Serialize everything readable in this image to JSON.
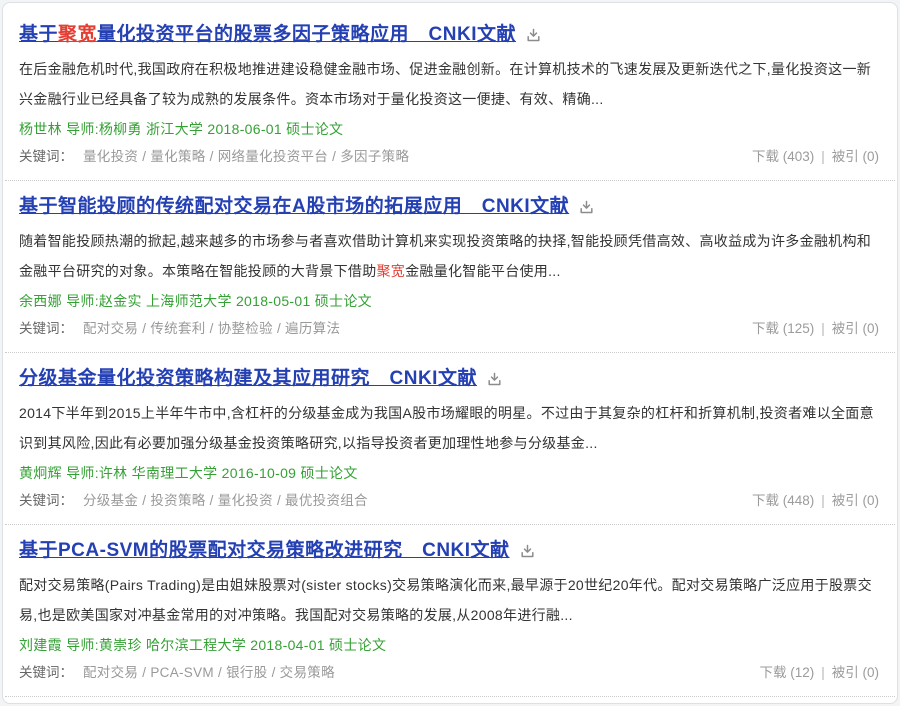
{
  "page": {
    "background_color": "#f2f4f5",
    "container_background": "#ffffff",
    "container_border_color": "#dde0e4"
  },
  "colors": {
    "link_blue": "#2440b3",
    "highlight_red": "#e33e33",
    "author_green": "#35a135",
    "abstract_text": "#333333",
    "keyword_gray": "#999999",
    "stats_gray": "#9b9b9b"
  },
  "icons": {
    "download": "tray-arrow-down-icon"
  },
  "labels": {
    "keywords_label": "关键词：",
    "keyword_separator": "/",
    "stats_divider": "|"
  },
  "results": [
    {
      "title_parts": [
        {
          "text": "基于"
        },
        {
          "text": "聚宽",
          "highlight": true
        },
        {
          "text": "量化投资平台的股票多因子策略应用　CNKI文献"
        }
      ],
      "abstract_parts": [
        {
          "text": "在后金融危机时代,我国政府在积极地推进建设稳健金融市场、促进金融创新。在计算机技术的飞速发展及更新迭代之下,量化投资这一新兴金融行业已经具备了较为成熟的发展条件。资本市场对于量化投资这一便捷、有效、精确..."
        }
      ],
      "author_line": "杨世林 导师:杨柳勇 浙江大学 2018-06-01 硕士论文",
      "keywords": [
        "量化投资",
        "量化策略",
        "网络量化投资平台",
        "多因子策略"
      ],
      "stats": {
        "download_text": "下载 (403)",
        "cited_text": "被引 (0)"
      }
    },
    {
      "title_parts": [
        {
          "text": "基于智能投顾的传统配对交易在A股市场的拓展应用　CNKI文献"
        }
      ],
      "abstract_parts": [
        {
          "text": "随着智能投顾热潮的掀起,越来越多的市场参与者喜欢借助计算机来实现投资策略的抉择,智能投顾凭借高效、高收益成为许多金融机构和金融平台研究的对象。本策略在智能投顾的大背景下借助"
        },
        {
          "text": "聚宽",
          "highlight": true
        },
        {
          "text": "金融量化智能平台使用..."
        }
      ],
      "author_line": "余西娜 导师:赵金实 上海师范大学 2018-05-01 硕士论文",
      "keywords": [
        "配对交易",
        "传统套利",
        "协整检验",
        "遍历算法"
      ],
      "stats": {
        "download_text": "下载 (125)",
        "cited_text": "被引 (0)"
      }
    },
    {
      "title_parts": [
        {
          "text": "分级基金量化投资策略构建及其应用研究　CNKI文献"
        }
      ],
      "abstract_parts": [
        {
          "text": "2014下半年到2015上半年牛市中,含杠杆的分级基金成为我国A股市场耀眼的明星。不过由于其复杂的杠杆和折算机制,投资者难以全面意识到其风险,因此有必要加强分级基金投资策略研究,以指导投资者更加理性地参与分级基金..."
        }
      ],
      "author_line": "黄炯辉 导师:许林 华南理工大学 2016-10-09 硕士论文",
      "keywords": [
        "分级基金",
        "投资策略",
        "量化投资",
        "最优投资组合"
      ],
      "stats": {
        "download_text": "下载 (448)",
        "cited_text": "被引 (0)"
      }
    },
    {
      "title_parts": [
        {
          "text": "基于PCA-SVM的股票配对交易策略改进研究　CNKI文献"
        }
      ],
      "abstract_parts": [
        {
          "text": "配对交易策略(Pairs Trading)是由姐妹股票对(sister stocks)交易策略演化而来,最早源于20世纪20年代。配对交易策略广泛应用于股票交易,也是欧美国家对冲基金常用的对冲策略。我国配对交易策略的发展,从2008年进行融..."
        }
      ],
      "author_line": "刘建霞 导师:黄崇珍 哈尔滨工程大学 2018-04-01 硕士论文",
      "keywords": [
        "配对交易",
        "PCA-SVM",
        "银行股",
        "交易策略"
      ],
      "stats": {
        "download_text": "下载 (12)",
        "cited_text": "被引 (0)"
      }
    }
  ]
}
